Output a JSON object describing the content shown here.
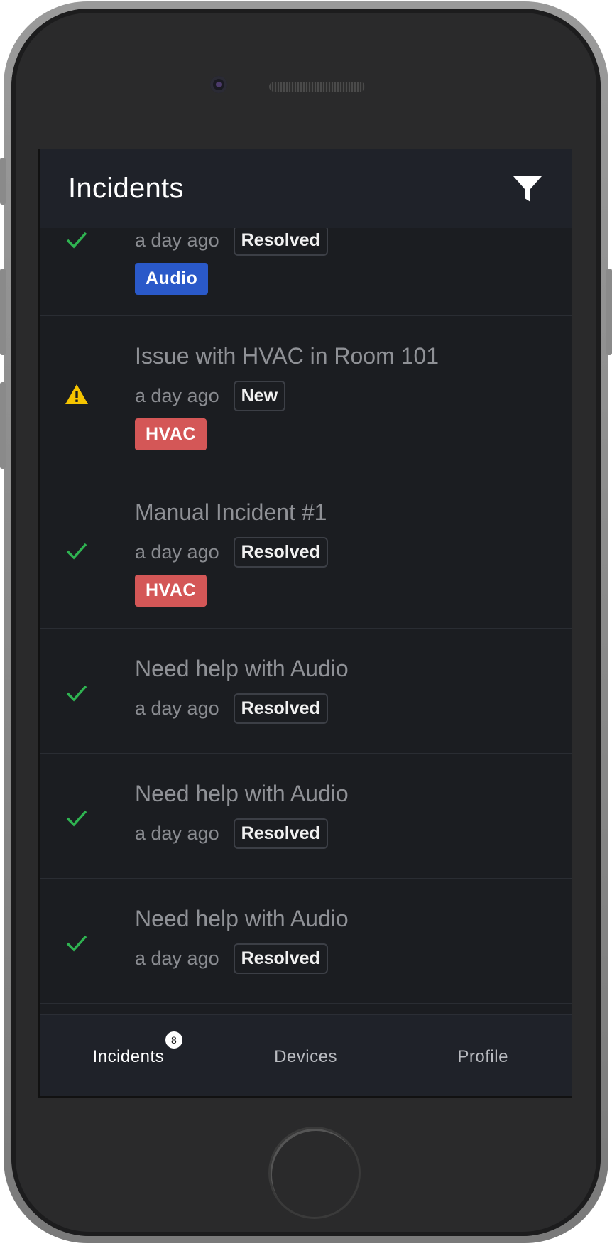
{
  "header": {
    "title": "Incidents"
  },
  "incidents": [
    {
      "title": "",
      "time": "a day ago",
      "status": "Resolved",
      "status_icon": "check-icon",
      "tag": "Audio",
      "tag_color": "#2a59c9"
    },
    {
      "title": "Issue with HVAC in Room 101",
      "time": "a day ago",
      "status": "New",
      "status_icon": "warning-icon",
      "tag": "HVAC",
      "tag_color": "#d45757"
    },
    {
      "title": "Manual Incident #1",
      "time": "a day ago",
      "status": "Resolved",
      "status_icon": "check-icon",
      "tag": "HVAC",
      "tag_color": "#d45757"
    },
    {
      "title": "Need help with Audio",
      "time": "a day ago",
      "status": "Resolved",
      "status_icon": "check-icon"
    },
    {
      "title": "Need help with Audio",
      "time": "a day ago",
      "status": "Resolved",
      "status_icon": "check-icon"
    },
    {
      "title": "Need help with Audio",
      "time": "a day ago",
      "status": "Resolved",
      "status_icon": "check-icon"
    }
  ],
  "nav": {
    "incidents_label": "Incidents",
    "incidents_badge": "8",
    "devices_label": "Devices",
    "profile_label": "Profile"
  },
  "colors": {
    "check": "#2fb351",
    "warning": "#f5c400",
    "audio_tag": "#2a59c9",
    "hvac_tag": "#d45757"
  }
}
